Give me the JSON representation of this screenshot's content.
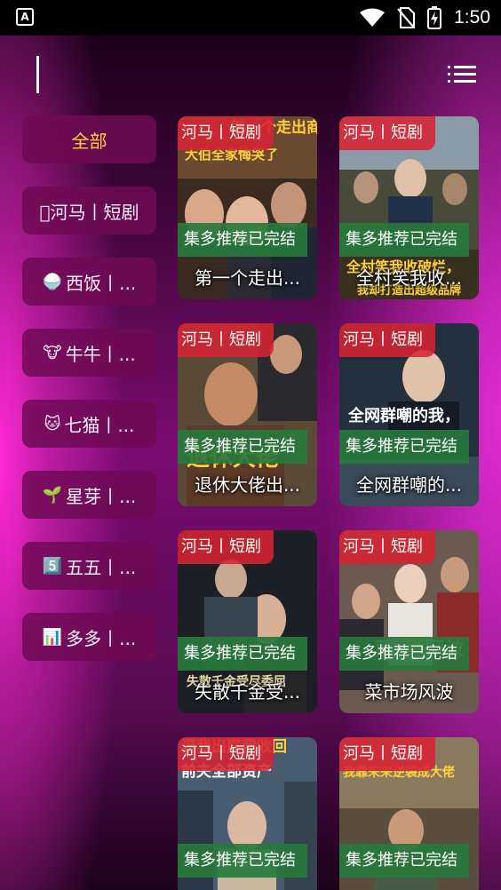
{
  "status_bar": {
    "app_badge": "A",
    "time": "1:50",
    "icons": [
      "wifi-icon",
      "no-sim-icon",
      "battery-charging-icon"
    ]
  },
  "header": {
    "menu_icon": "list-menu-icon"
  },
  "sidebar": {
    "items": [
      {
        "emoji": "",
        "label": "全部",
        "active": true
      },
      {
        "emoji": "",
        "label": "\u0000河马丨短剧",
        "active": false
      },
      {
        "emoji": "🍚",
        "label": "西饭丨...",
        "active": false
      },
      {
        "emoji": "🐮",
        "label": "牛牛丨...",
        "active": false
      },
      {
        "emoji": "🐱",
        "label": "七猫丨...",
        "active": false
      },
      {
        "emoji": "🌱",
        "label": "星芽丨...",
        "active": false
      },
      {
        "emoji": "5️⃣",
        "label": "五五丨...",
        "active": false
      },
      {
        "emoji": "📊",
        "label": "多多丨...",
        "active": false
      }
    ]
  },
  "cards": [
    {
      "tag": "河马丨短剧",
      "status": "集多推荐已完结",
      "title": "第一个走出...",
      "poster_text": "第一个走出商场，\n大伯全家悔哭了"
    },
    {
      "tag": "河马丨短剧",
      "status": "集多推荐已完结",
      "title": "全村笑我收...",
      "poster_text": "全村笑我收破烂，\n我却打造出超级品牌"
    },
    {
      "tag": "河马丨短剧",
      "status": "集多推荐已完结",
      "title": "退休大佬出...",
      "poster_text": "退休大佬"
    },
    {
      "tag": "河马丨短剧",
      "status": "集多推荐已完结",
      "title": "全网群嘲的...",
      "poster_text": "全网群嘲的我，"
    },
    {
      "tag": "河马丨短剧",
      "status": "集多推荐已完结",
      "title": "失散千金受...",
      "poster_text": "失散千金受尽委屈"
    },
    {
      "tag": "河马丨短剧",
      "status": "集多推荐已完结",
      "title": "菜市场风波",
      "poster_text": "菜市场风波"
    },
    {
      "tag": "河马丨短剧",
      "status": "集多推荐已完结",
      "title": "",
      "poster_text": "逼我出庭我收回\n前夫全部资产"
    },
    {
      "tag": "河马丨短剧",
      "status": "集多推荐已完结",
      "title": "",
      "poster_text": "我靠未来逆袭成大佬"
    }
  ],
  "colors": {
    "active": "#ffd23a",
    "tag_bg": "#d72332",
    "status_bg": "#28783c",
    "sidebar_bg": "#6e0a55"
  }
}
